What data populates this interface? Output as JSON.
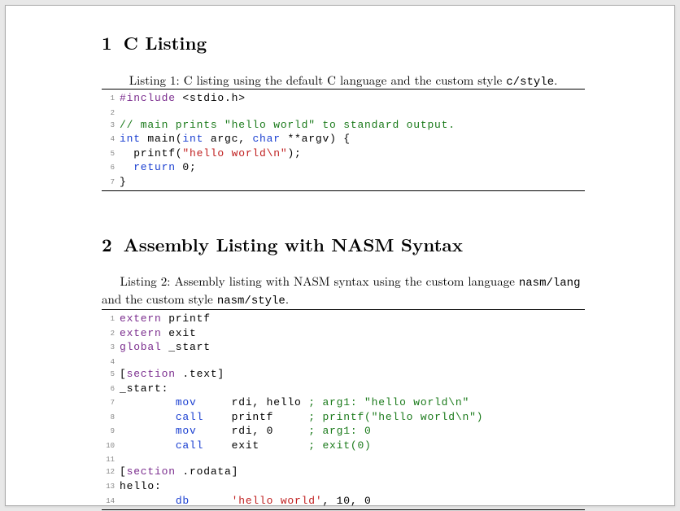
{
  "section1": {
    "number": "1",
    "title": "C Listing",
    "caption_prefix": "Listing 1: C listing using the default C language and the custom style ",
    "caption_code": "c/style",
    "caption_suffix": ".",
    "lines": [
      {
        "n": "1",
        "segs": [
          {
            "cls": "kw-pre",
            "t": "#include"
          },
          {
            "cls": "",
            "t": " <"
          },
          {
            "cls": "",
            "t": "stdio"
          },
          {
            "cls": "",
            "t": "."
          },
          {
            "cls": "",
            "t": "h"
          },
          {
            "cls": "",
            "t": ">"
          }
        ]
      },
      {
        "n": "2",
        "segs": [
          {
            "cls": "",
            "t": ""
          }
        ]
      },
      {
        "n": "3",
        "segs": [
          {
            "cls": "cmt",
            "t": "// main prints \"hello world\" to standard output."
          }
        ]
      },
      {
        "n": "4",
        "segs": [
          {
            "cls": "kw-type",
            "t": "int"
          },
          {
            "cls": "",
            "t": " main("
          },
          {
            "cls": "kw-type",
            "t": "int"
          },
          {
            "cls": "",
            "t": " argc, "
          },
          {
            "cls": "kw-type",
            "t": "char"
          },
          {
            "cls": "",
            "t": " **argv) {"
          }
        ]
      },
      {
        "n": "5",
        "segs": [
          {
            "cls": "",
            "t": "  printf("
          },
          {
            "cls": "str",
            "t": "\"hello world\\n\""
          },
          {
            "cls": "",
            "t": ");"
          }
        ]
      },
      {
        "n": "6",
        "segs": [
          {
            "cls": "",
            "t": "  "
          },
          {
            "cls": "kw-type",
            "t": "return"
          },
          {
            "cls": "",
            "t": " 0;"
          }
        ]
      },
      {
        "n": "7",
        "segs": [
          {
            "cls": "",
            "t": "}"
          }
        ]
      }
    ]
  },
  "section2": {
    "number": "2",
    "title": "Assembly Listing with NASM Syntax",
    "caption_prefix": "Listing 2:  Assembly listing with NASM syntax using the custom language ",
    "caption_code1": "nasm/lang",
    "caption_mid": " and the custom style ",
    "caption_code2": "nasm/style",
    "caption_suffix": ".",
    "lines": [
      {
        "n": "1",
        "segs": [
          {
            "cls": "kw-pre",
            "t": "extern"
          },
          {
            "cls": "",
            "t": " printf"
          }
        ]
      },
      {
        "n": "2",
        "segs": [
          {
            "cls": "kw-pre",
            "t": "extern"
          },
          {
            "cls": "",
            "t": " exit"
          }
        ]
      },
      {
        "n": "3",
        "segs": [
          {
            "cls": "kw-pre",
            "t": "global"
          },
          {
            "cls": "",
            "t": " _start"
          }
        ]
      },
      {
        "n": "4",
        "segs": [
          {
            "cls": "",
            "t": ""
          }
        ]
      },
      {
        "n": "5",
        "segs": [
          {
            "cls": "",
            "t": "["
          },
          {
            "cls": "kw-pre",
            "t": "section"
          },
          {
            "cls": "",
            "t": " .text]"
          }
        ]
      },
      {
        "n": "6",
        "segs": [
          {
            "cls": "",
            "t": "_start:"
          }
        ]
      },
      {
        "n": "7",
        "segs": [
          {
            "cls": "",
            "t": "        "
          },
          {
            "cls": "kw-type",
            "t": "mov"
          },
          {
            "cls": "",
            "t": "     rdi, hello "
          },
          {
            "cls": "cmt",
            "t": "; arg1: \"hello world\\n\""
          }
        ]
      },
      {
        "n": "8",
        "segs": [
          {
            "cls": "",
            "t": "        "
          },
          {
            "cls": "kw-type",
            "t": "call"
          },
          {
            "cls": "",
            "t": "    printf     "
          },
          {
            "cls": "cmt",
            "t": "; printf(\"hello world\\n\")"
          }
        ]
      },
      {
        "n": "9",
        "segs": [
          {
            "cls": "",
            "t": "        "
          },
          {
            "cls": "kw-type",
            "t": "mov"
          },
          {
            "cls": "",
            "t": "     rdi, 0     "
          },
          {
            "cls": "cmt",
            "t": "; arg1: 0"
          }
        ]
      },
      {
        "n": "10",
        "segs": [
          {
            "cls": "",
            "t": "        "
          },
          {
            "cls": "kw-type",
            "t": "call"
          },
          {
            "cls": "",
            "t": "    exit       "
          },
          {
            "cls": "cmt",
            "t": "; exit(0)"
          }
        ]
      },
      {
        "n": "11",
        "segs": [
          {
            "cls": "",
            "t": ""
          }
        ]
      },
      {
        "n": "12",
        "segs": [
          {
            "cls": "",
            "t": "["
          },
          {
            "cls": "kw-pre",
            "t": "section"
          },
          {
            "cls": "",
            "t": " .rodata]"
          }
        ]
      },
      {
        "n": "13",
        "segs": [
          {
            "cls": "",
            "t": "hello:"
          }
        ]
      },
      {
        "n": "14",
        "segs": [
          {
            "cls": "",
            "t": "        "
          },
          {
            "cls": "kw-type",
            "t": "db"
          },
          {
            "cls": "",
            "t": "      "
          },
          {
            "cls": "str",
            "t": "'hello world'"
          },
          {
            "cls": "",
            "t": ", 10, 0"
          }
        ]
      }
    ]
  }
}
